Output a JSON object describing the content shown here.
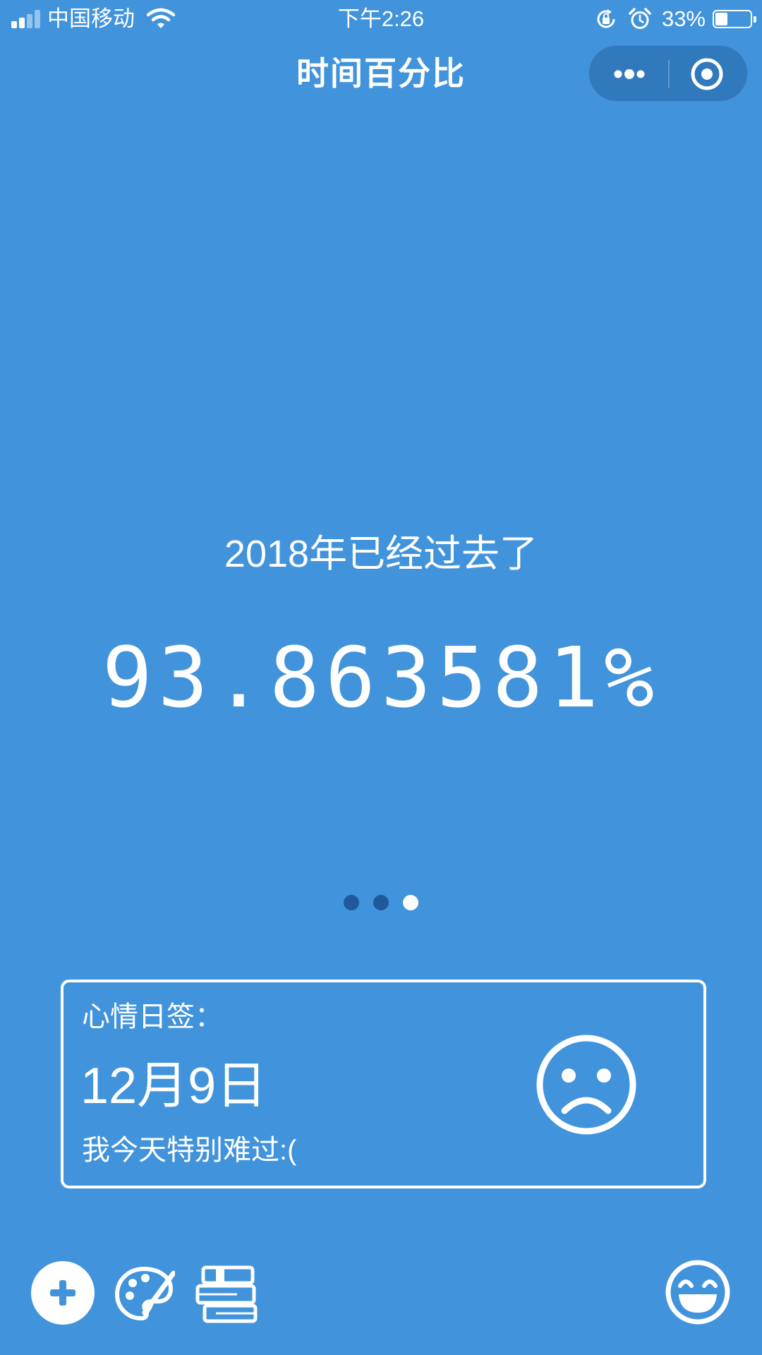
{
  "status_bar": {
    "carrier": "中国移动",
    "time": "下午2:26",
    "battery_percent": "33%",
    "battery_level": 0.33,
    "icons": [
      "signal-icon",
      "wifi-icon",
      "rotation-lock-icon",
      "alarm-icon",
      "battery-icon"
    ]
  },
  "nav": {
    "title": "时间百分比",
    "capsule_icons": [
      "more-dots-icon",
      "close-target-icon"
    ]
  },
  "main": {
    "subtitle": "2018年已经过去了",
    "percent": "93.863581%",
    "pager": {
      "count": 3,
      "active_index": 2
    }
  },
  "mood_card": {
    "label": "心情日签：",
    "date": "12月9日",
    "note": "我今天特别难过:(",
    "face_icon": "sad-face-icon"
  },
  "toolbar": {
    "icons": [
      "add-icon",
      "palette-icon",
      "books-icon",
      "happy-face-icon"
    ]
  },
  "colors": {
    "background": "#4193DC",
    "foreground": "#FFFFFF",
    "pager_inactive": "#1E5A99"
  }
}
